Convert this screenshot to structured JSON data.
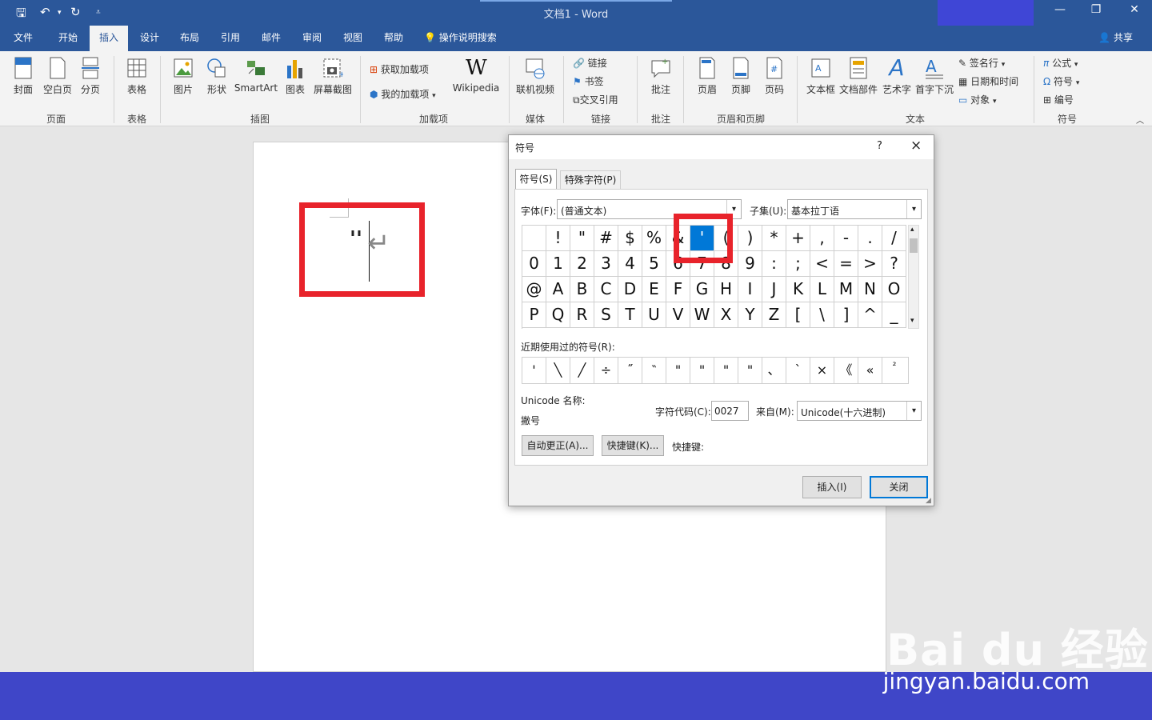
{
  "app": {
    "title": "文档1  -  Word"
  },
  "menu": {
    "tabs": [
      "文件",
      "开始",
      "插入",
      "设计",
      "布局",
      "引用",
      "邮件",
      "审阅",
      "视图",
      "帮助"
    ],
    "active_tab": "插入",
    "tell_me": "操作说明搜索",
    "share": "共享"
  },
  "ribbon": {
    "pages": {
      "cover": "封面",
      "blank": "空白页",
      "break": "分页",
      "label": "页面"
    },
    "tables": {
      "table": "表格",
      "label": "表格"
    },
    "illustrations": {
      "picture": "图片",
      "shapes": "形状",
      "smartart": "SmartArt",
      "chart": "图表",
      "screenshot": "屏幕截图",
      "label": "插图"
    },
    "addins": {
      "get": "获取加载项",
      "my": "我的加载项",
      "wikipedia": "Wikipedia",
      "label": "加载项"
    },
    "media": {
      "video": "联机视频",
      "label": "媒体"
    },
    "links": {
      "link": "链接",
      "bookmark": "书签",
      "crossref": "交叉引用",
      "label": "链接"
    },
    "comments": {
      "comment": "批注",
      "label": "批注"
    },
    "header_footer": {
      "header": "页眉",
      "footer": "页脚",
      "page_number": "页码",
      "label": "页眉和页脚"
    },
    "text": {
      "textbox": "文本框",
      "quickparts": "文档部件",
      "wordart": "艺术字",
      "dropcap": "首字下沉",
      "signature": "签名行",
      "datetime": "日期和时间",
      "object": "对象",
      "label": "文本"
    },
    "symbols": {
      "equation": "公式",
      "symbol": "符号",
      "number": "编号",
      "label": "符号"
    }
  },
  "document": {
    "text": "''"
  },
  "dialog": {
    "title": "符号",
    "help": "?",
    "close_x": "×",
    "tabs": [
      "符号(S)",
      "特殊字符(P)"
    ],
    "font_label": "字体(F):",
    "font_value": "(普通文本)",
    "subset_label": "子集(U):",
    "subset_value": "基本拉丁语",
    "symbols": [
      [
        "",
        "!",
        "\"",
        "#",
        "$",
        "%",
        "&",
        "'",
        "(",
        ")",
        "*",
        "+",
        ",",
        "-",
        ".",
        "/"
      ],
      [
        "0",
        "1",
        "2",
        "3",
        "4",
        "5",
        "6",
        "7",
        "8",
        "9",
        ":",
        ";",
        "<",
        "=",
        ">",
        "?"
      ],
      [
        "@",
        "A",
        "B",
        "C",
        "D",
        "E",
        "F",
        "G",
        "H",
        "I",
        "J",
        "K",
        "L",
        "M",
        "N",
        "O"
      ],
      [
        "P",
        "Q",
        "R",
        "S",
        "T",
        "U",
        "V",
        "W",
        "X",
        "Y",
        "Z",
        "[",
        "\\",
        "]",
        "^",
        "_"
      ]
    ],
    "recent_label": "近期使用过的符号(R):",
    "recent": [
      "'",
      "╲",
      "╱",
      "÷",
      "˝",
      "‶",
      "\"",
      "\"",
      "\"",
      "\"",
      "、",
      "`",
      "×",
      "《",
      "«",
      "²"
    ],
    "unicode_name_label": "Unicode 名称:",
    "unicode_name": "撇号",
    "char_code_label": "字符代码(C):",
    "char_code": "0027",
    "from_label": "来自(M):",
    "from_value": "Unicode(十六进制)",
    "autocorrect": "自动更正(A)...",
    "shortcut_btn": "快捷键(K)...",
    "shortcut_label": "快捷键:",
    "insert": "插入(I)",
    "close": "关闭"
  },
  "watermark": {
    "brand": "Bai du 经验",
    "url": "jingyan.baidu.com"
  },
  "colors": {
    "accent": "#2b579a",
    "selection": "#0078d7",
    "highlight": "#e8232b",
    "bottom": "#3f46c8"
  }
}
